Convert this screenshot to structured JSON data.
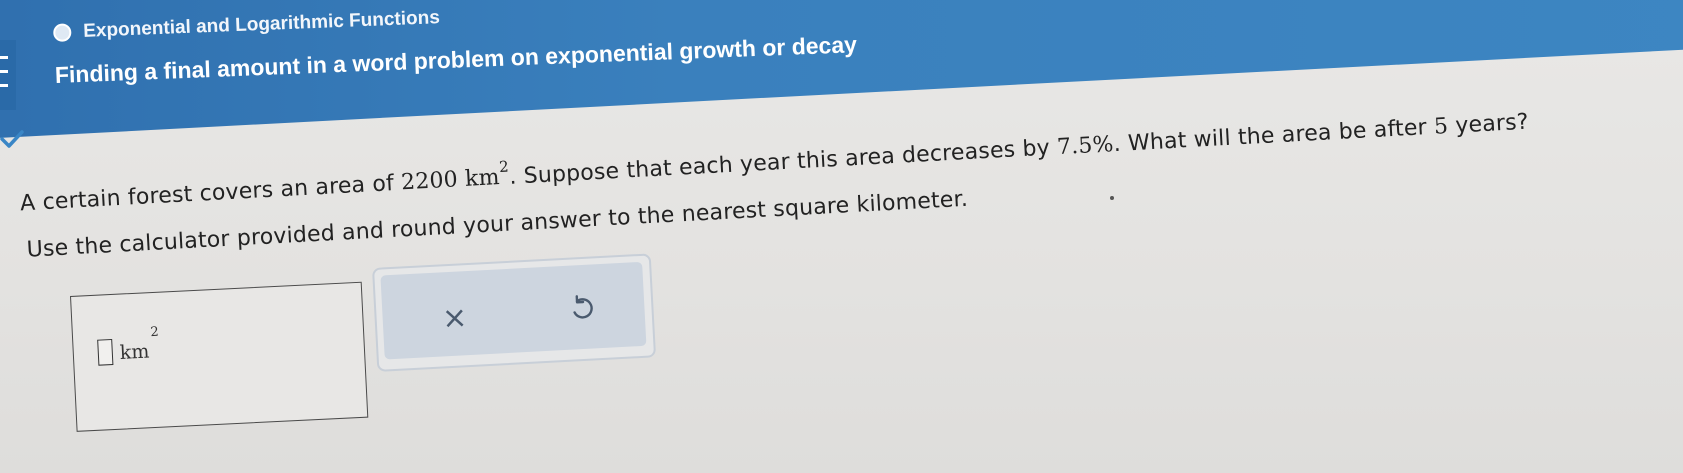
{
  "header": {
    "topic": "Exponential and Logarithmic Functions",
    "title": "Finding a final amount in a word problem on exponential growth or decay"
  },
  "problem": {
    "line1_a": "A certain forest covers an area of ",
    "area_value": "2200",
    "area_unit": "km",
    "area_exp": "2",
    "line1_b": ". Suppose that each year this area decreases by ",
    "rate": "7.5%",
    "line1_c": ". What will the area be after ",
    "years": "5",
    "line1_d": " years?",
    "line1_e": "Use the calculator provided and round your answer to the nearest square kilometer.",
    "line2": "Use the calculator provided and round your answer to the nearest square kilometer."
  },
  "answer": {
    "value": "",
    "unit": "km",
    "unit_exp": "2"
  },
  "controls": {
    "clear_symbol": "×"
  },
  "colors": {
    "header_blue": "#3a80bd",
    "panel_bg": "#cdd5df",
    "icon": "#4a5a6e"
  }
}
